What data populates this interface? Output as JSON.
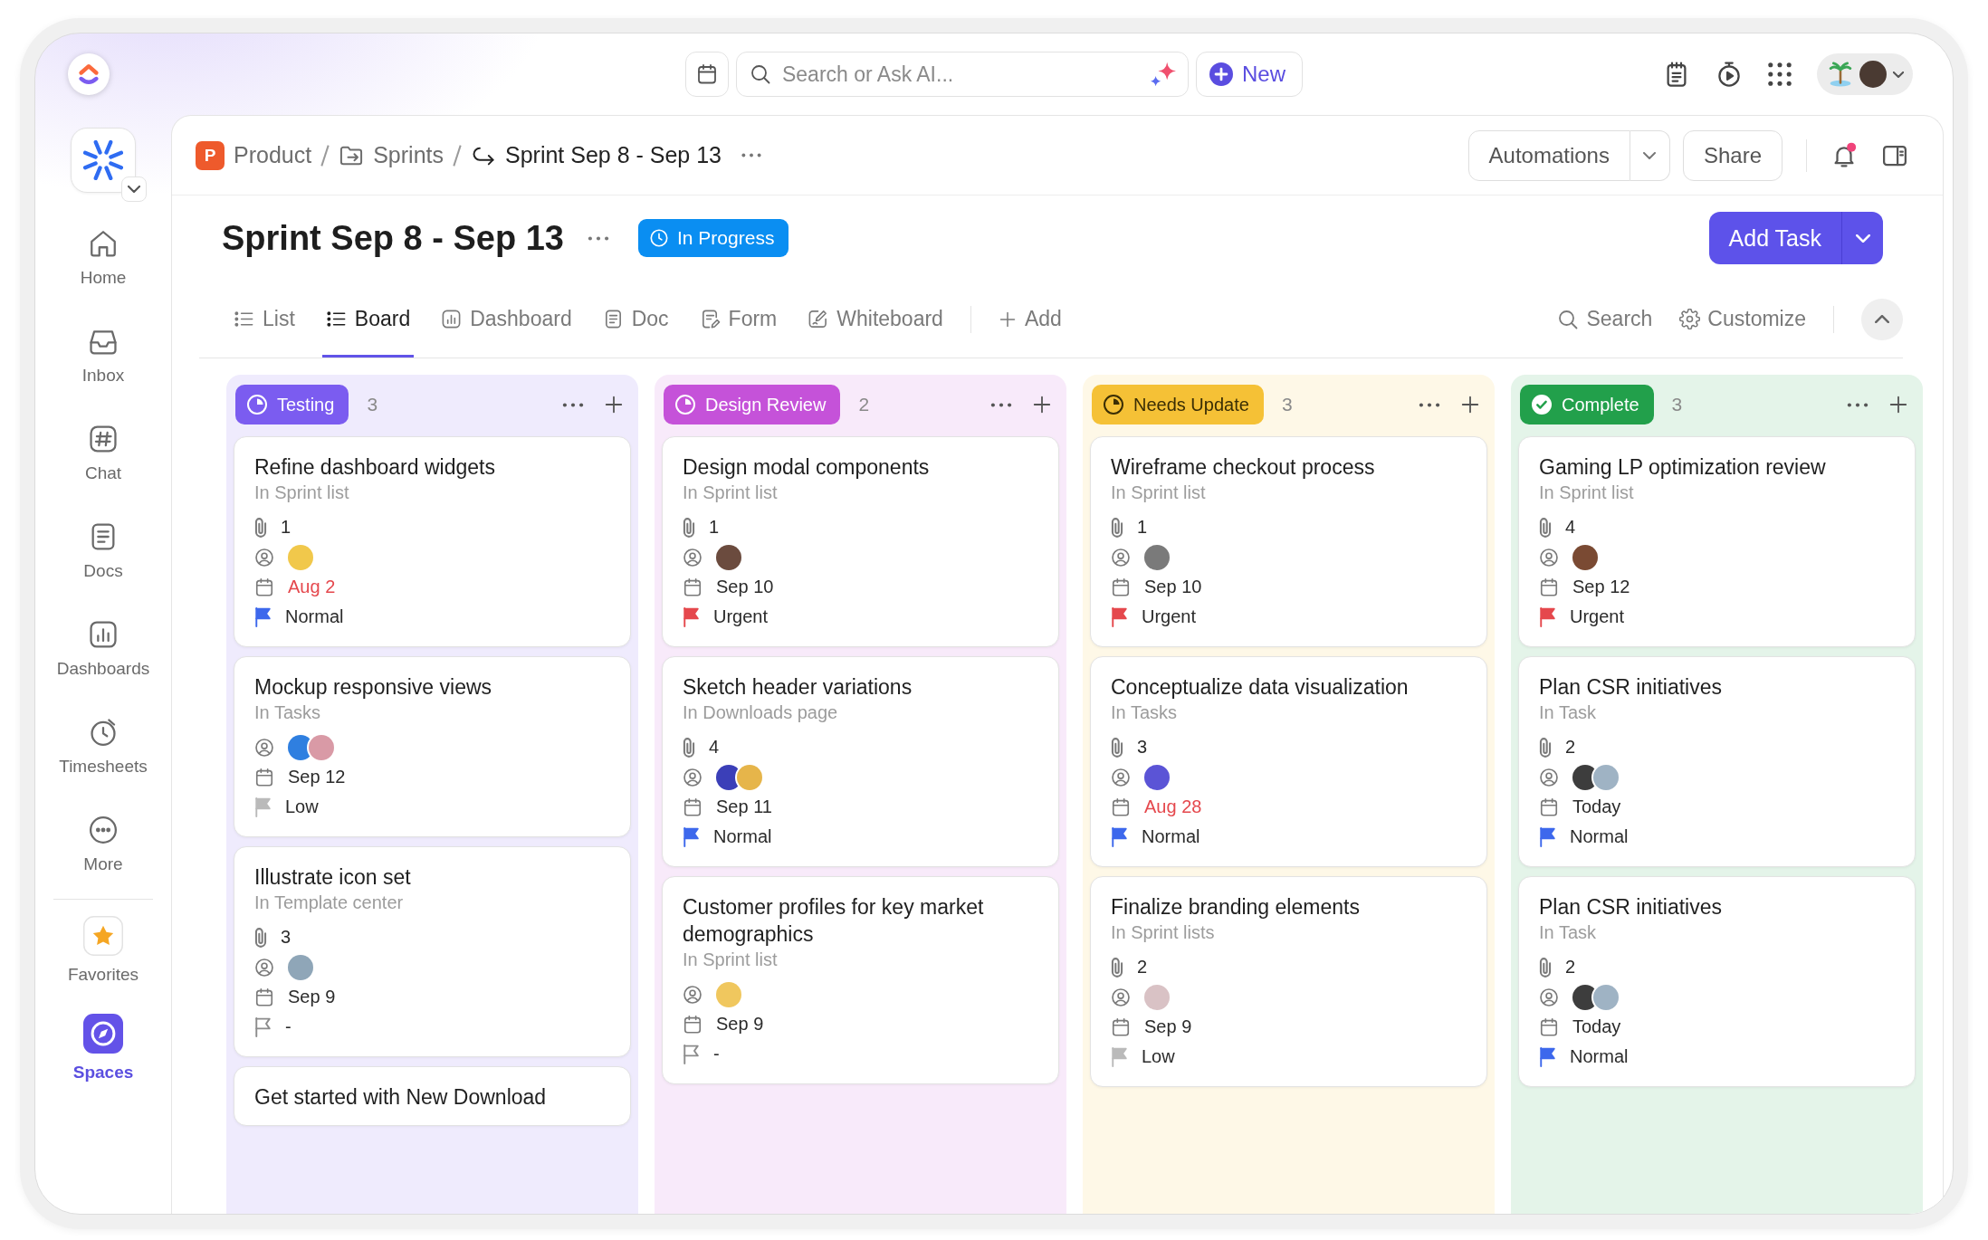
{
  "top_bar": {
    "search": {
      "placeholder": "Search or Ask AI..."
    },
    "new_button": "New"
  },
  "sidebar": {
    "items": [
      {
        "label": "Home",
        "selected": false
      },
      {
        "label": "Inbox",
        "selected": false
      },
      {
        "label": "Chat",
        "selected": false
      },
      {
        "label": "Docs",
        "selected": false
      },
      {
        "label": "Dashboards",
        "selected": false
      },
      {
        "label": "Timesheets",
        "selected": false
      },
      {
        "label": "More",
        "selected": false
      }
    ],
    "pinned": [
      {
        "label": "Favorites",
        "selected": false
      },
      {
        "label": "Spaces",
        "selected": true
      }
    ]
  },
  "header": {
    "breadcrumb": [
      {
        "label": "Product",
        "initial": "P"
      },
      {
        "label": "Sprints"
      },
      {
        "label": "Sprint Sep 8 - Sep 13"
      }
    ],
    "automations_button": "Automations",
    "share_button": "Share",
    "unread": true
  },
  "title_row": {
    "title": "Sprint Sep 8 - Sep 13",
    "status": "In Progress",
    "add_task_button": "Add Task"
  },
  "views": {
    "tabs": [
      {
        "label": "List",
        "selected": false
      },
      {
        "label": "Board",
        "selected": true
      },
      {
        "label": "Dashboard",
        "selected": false
      },
      {
        "label": "Doc",
        "selected": false
      },
      {
        "label": "Form",
        "selected": false
      },
      {
        "label": "Whiteboard",
        "selected": false
      }
    ],
    "add_view": "Add",
    "search": "Search",
    "customize": "Customize"
  },
  "board": {
    "columns": [
      {
        "name": "Testing",
        "count": "3",
        "color": "#7b5cf0",
        "done": false,
        "cards": [
          {
            "title": "Refine dashboard widgets",
            "location": "In Sprint list",
            "attachments": "1",
            "assignees": [
              {
                "color": "#f1c84b"
              }
            ],
            "due": "Aug 2",
            "overdue": true,
            "priority": {
              "label": "Normal",
              "kind": "normal"
            }
          },
          {
            "title": "Mockup responsive views",
            "location": "In Tasks",
            "assignees": [
              {
                "color": "#2f7fe0"
              },
              {
                "color": "#d99aa6"
              }
            ],
            "due": "Sep 12",
            "overdue": false,
            "priority": {
              "label": "Low",
              "kind": "low"
            }
          },
          {
            "title": "Illustrate icon set",
            "location": "In Template center",
            "attachments": "3",
            "assignees": [
              {
                "color": "#8fa6b8"
              }
            ],
            "due": "Sep 9",
            "overdue": false,
            "priority": {
              "label": "-",
              "kind": "none"
            }
          },
          {
            "title": "Get started with New Download"
          }
        ]
      },
      {
        "name": "Design Review",
        "count": "2",
        "color": "#c552d9",
        "done": false,
        "cards": [
          {
            "title": "Design modal components",
            "location": "In Sprint list",
            "attachments": "1",
            "assignees": [
              {
                "color": "#6b4b3e"
              }
            ],
            "due": "Sep 10",
            "overdue": false,
            "priority": {
              "label": "Urgent",
              "kind": "urgent"
            }
          },
          {
            "title": "Sketch header variations",
            "location": "In Downloads page",
            "attachments": "4",
            "assignees": [
              {
                "color": "#3b3fb8"
              },
              {
                "color": "#e6b54a"
              }
            ],
            "due": "Sep 11",
            "overdue": false,
            "priority": {
              "label": "Normal",
              "kind": "normal"
            }
          },
          {
            "title": "Customer profiles for key market demographics",
            "location": "In Sprint list",
            "assignees": [
              {
                "color": "#f0c75e"
              }
            ],
            "due": "Sep 9",
            "overdue": false,
            "priority": {
              "label": "-",
              "kind": "none"
            }
          }
        ]
      },
      {
        "name": "Needs Update",
        "count": "3",
        "color": "#f5c136",
        "done": false,
        "cards": [
          {
            "title": "Wireframe checkout process",
            "location": "In Sprint list",
            "attachments": "1",
            "assignees": [
              {
                "color": "#7a7a7a"
              }
            ],
            "due": "Sep 10",
            "overdue": false,
            "priority": {
              "label": "Urgent",
              "kind": "urgent"
            }
          },
          {
            "title": "Conceptualize data visualization",
            "location": "In Tasks",
            "attachments": "3",
            "assignees": [
              {
                "color": "#5b54d6"
              }
            ],
            "due": "Aug 28",
            "overdue": true,
            "priority": {
              "label": "Normal",
              "kind": "normal"
            }
          },
          {
            "title": "Finalize branding elements",
            "location": "In Sprint lists",
            "attachments": "2",
            "assignees": [
              {
                "color": "#d9c2c5"
              }
            ],
            "due": "Sep 9",
            "overdue": false,
            "priority": {
              "label": "Low",
              "kind": "low"
            }
          }
        ]
      },
      {
        "name": "Complete",
        "count": "3",
        "color": "#22a04b",
        "done": true,
        "cards": [
          {
            "title": "Gaming LP optimization review",
            "location": "In Sprint list",
            "attachments": "4",
            "assignees": [
              {
                "color": "#7a4a33"
              }
            ],
            "due": "Sep 12",
            "overdue": false,
            "priority": {
              "label": "Urgent",
              "kind": "urgent"
            }
          },
          {
            "title": "Plan CSR initiatives",
            "location": "In Task",
            "attachments": "2",
            "assignees": [
              {
                "color": "#3d3d3d"
              },
              {
                "color": "#9fb3c4"
              }
            ],
            "due": "Today",
            "overdue": false,
            "priority": {
              "label": "Normal",
              "kind": "normal"
            }
          },
          {
            "title": "Plan CSR initiatives",
            "location": "In Task",
            "attachments": "2",
            "assignees": [
              {
                "color": "#3d3d3d"
              },
              {
                "color": "#9fb3c4"
              }
            ],
            "due": "Today",
            "overdue": false,
            "priority": {
              "label": "Normal",
              "kind": "normal"
            }
          }
        ]
      }
    ]
  }
}
